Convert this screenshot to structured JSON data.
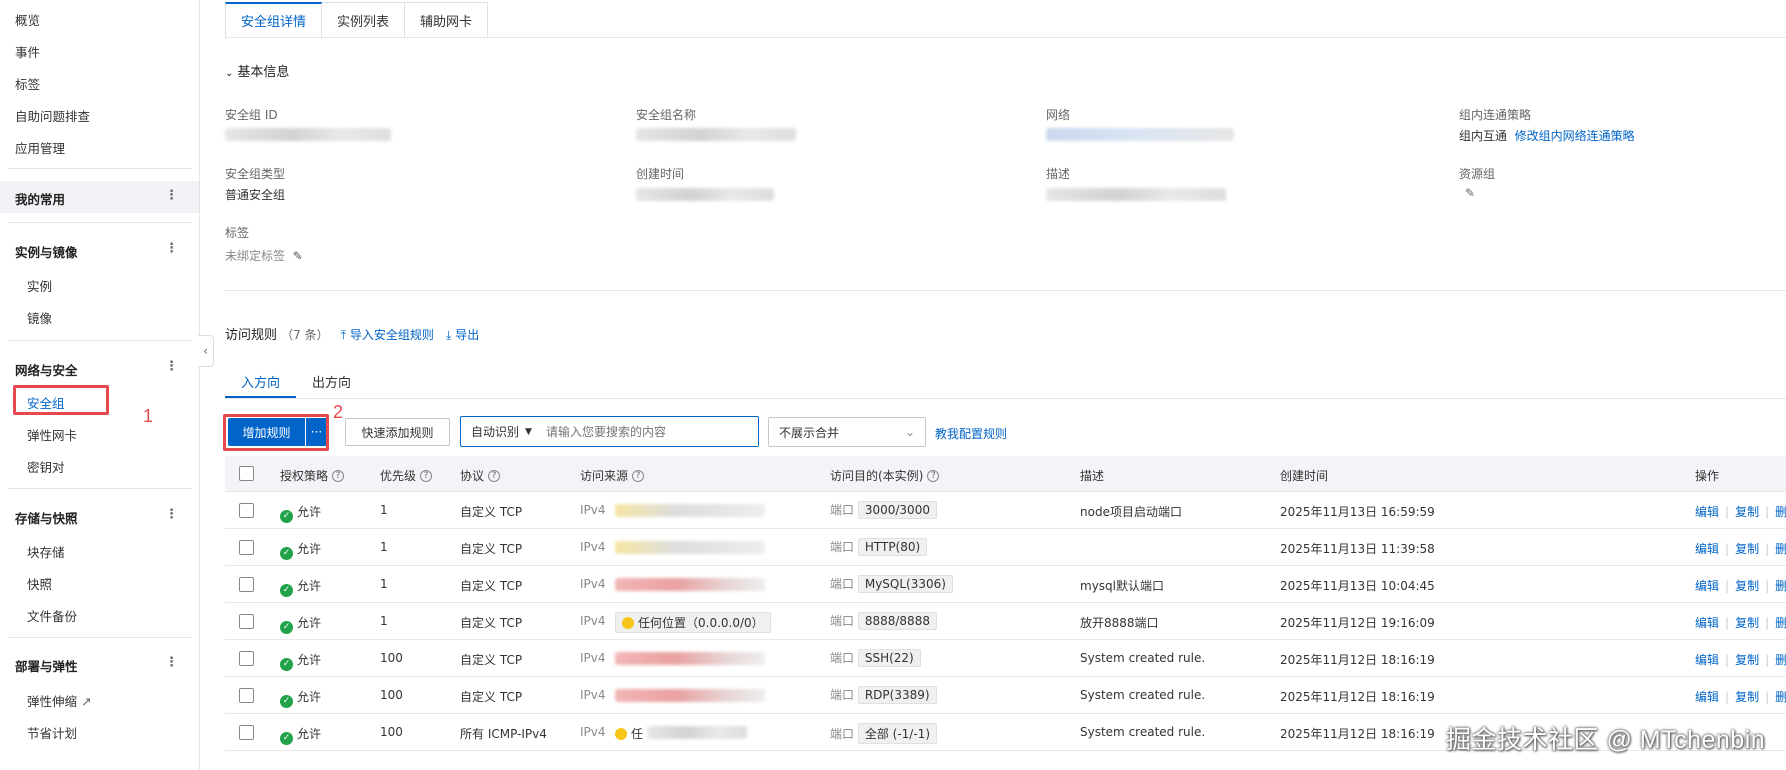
{
  "sidebar": {
    "top_items": [
      "概览",
      "事件",
      "标签",
      "自助问题排查",
      "应用管理"
    ],
    "favorites": "我的常用",
    "groups": [
      {
        "title": "实例与镜像",
        "items": [
          "实例",
          "镜像"
        ]
      },
      {
        "title": "网络与安全",
        "items": [
          "安全组",
          "弹性网卡",
          "密钥对"
        ]
      },
      {
        "title": "存储与快照",
        "items": [
          "块存储",
          "快照",
          "文件备份"
        ]
      },
      {
        "title": "部署与弹性",
        "items": [
          "弹性伸缩",
          "节省计划"
        ]
      }
    ],
    "annotation_1": "1",
    "annotation_2": "2"
  },
  "tabs": [
    "安全组详情",
    "实例列表",
    "辅助网卡"
  ],
  "basic_info": {
    "section_title": "基本信息",
    "fields": {
      "sg_id_label": "安全组 ID",
      "sg_name_label": "安全组名称",
      "network_label": "网络",
      "policy_label": "组内连通策略",
      "policy_value": "组内互通",
      "policy_link": "修改组内网络连通策略",
      "type_label": "安全组类型",
      "type_value": "普通安全组",
      "created_label": "创建时间",
      "desc_label": "描述",
      "rg_label": "资源组",
      "tag_label": "标签",
      "tag_value": "未绑定标签"
    }
  },
  "rules": {
    "title": "访问规则",
    "count": "（7 条）",
    "import_link": "导入安全组规则",
    "export_link": "导出",
    "directions": [
      "入方向",
      "出方向"
    ],
    "add_button": "增加规则",
    "more_button": "···",
    "quick_add": "快速添加规则",
    "search_type": "自动识别",
    "search_placeholder": "请输入您要搜索的内容",
    "merge_select": "不展示合并",
    "help_link": "教我配置规则",
    "columns": [
      "授权策略",
      "优先级",
      "协议",
      "访问来源",
      "访问目的(本实例)",
      "描述",
      "创建时间",
      "操作"
    ],
    "rows": [
      {
        "policy": "允许",
        "priority": "1",
        "protocol": "自定义 TCP",
        "src_type": "IPv4",
        "src_text": "",
        "dst_prefix": "端口",
        "dst": "3000/3000",
        "desc": "node项目启动端口",
        "created": "2025年11月13日 16:59:59"
      },
      {
        "policy": "允许",
        "priority": "1",
        "protocol": "自定义 TCP",
        "src_type": "IPv4",
        "src_text": "",
        "dst_prefix": "端口",
        "dst": "HTTP(80)",
        "desc": "",
        "created": "2025年11月13日 11:39:58"
      },
      {
        "policy": "允许",
        "priority": "1",
        "protocol": "自定义 TCP",
        "src_type": "IPv4",
        "src_text": "",
        "dst_prefix": "端口",
        "dst": "MySQL(3306)",
        "desc": "mysql默认端口",
        "created": "2025年11月13日 10:04:45"
      },
      {
        "policy": "允许",
        "priority": "1",
        "protocol": "自定义 TCP",
        "src_type": "IPv4",
        "src_text": "任何位置（0.0.0.0/0）",
        "dst_prefix": "端口",
        "dst": "8888/8888",
        "desc": "放开8888端口",
        "created": "2025年11月12日 19:16:09"
      },
      {
        "policy": "允许",
        "priority": "100",
        "protocol": "自定义 TCP",
        "src_type": "IPv4",
        "src_text": "",
        "dst_prefix": "端口",
        "dst": "SSH(22)",
        "desc": "System created rule.",
        "created": "2025年11月12日 18:16:19"
      },
      {
        "policy": "允许",
        "priority": "100",
        "protocol": "自定义 TCP",
        "src_type": "IPv4",
        "src_text": "",
        "dst_prefix": "端口",
        "dst": "RDP(3389)",
        "desc": "System created rule.",
        "created": "2025年11月12日 18:16:19"
      },
      {
        "policy": "允许",
        "priority": "100",
        "protocol": "所有 ICMP-IPv4",
        "src_type": "IPv4",
        "src_text": "任",
        "dst_prefix": "端口",
        "dst": "全部 (-1/-1)",
        "desc": "System created rule.",
        "created": "2025年11月12日 18:16:19"
      }
    ],
    "actions": [
      "编辑",
      "复制",
      "删"
    ]
  },
  "watermark": "掘金技术社区 @ MTchenbin"
}
